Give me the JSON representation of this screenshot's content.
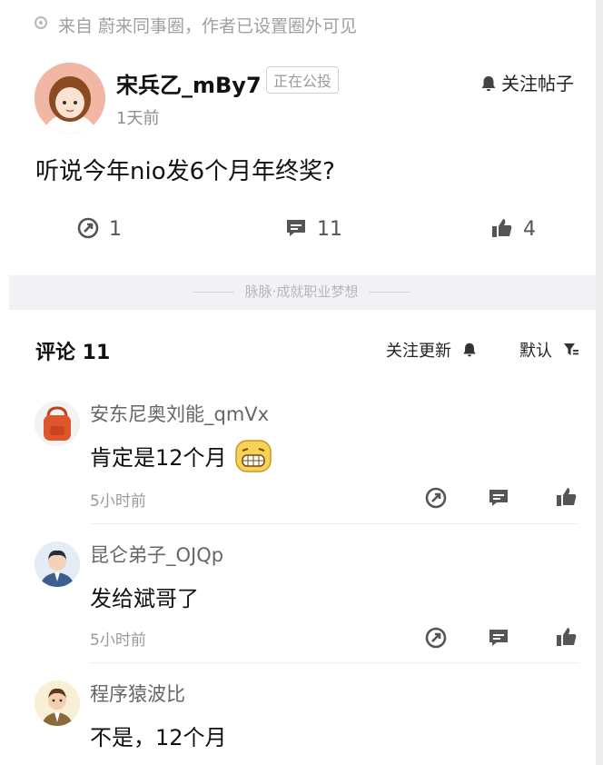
{
  "source": {
    "text": "来自 蔚来同事圈，作者已设置圈外可见",
    "icon": "circle-dot-icon"
  },
  "post": {
    "author": "宋兵乙_mBy7",
    "badge": "正在公投",
    "follow_label": "关注帖子",
    "time": "1天前",
    "question": "听说今年nio发6个月年终奖?",
    "stats": {
      "shares": "1",
      "comments": "11",
      "likes": "4"
    }
  },
  "slogan": "脉脉·成就职业梦想",
  "comments_section": {
    "title": "评论 11",
    "follow_update_label": "关注更新",
    "sort_label": "默认",
    "items": [
      {
        "name": "安东尼奥刘能_qmVx",
        "text": "肯定是12个月",
        "emoji": "grinning-emoji",
        "time": "5小时前",
        "avatar": "red-backpack-avatar"
      },
      {
        "name": "昆仑弟子_OJQp",
        "text": "发给斌哥了",
        "time": "5小时前",
        "avatar": "man-suit-avatar"
      },
      {
        "name": "程序猿波比",
        "text": "不是，12个月",
        "avatar": "cartoon-man-avatar"
      }
    ]
  },
  "colors": {
    "accent": "#222222",
    "muted": "#9a9a9a",
    "band": "#f2f2f6"
  }
}
